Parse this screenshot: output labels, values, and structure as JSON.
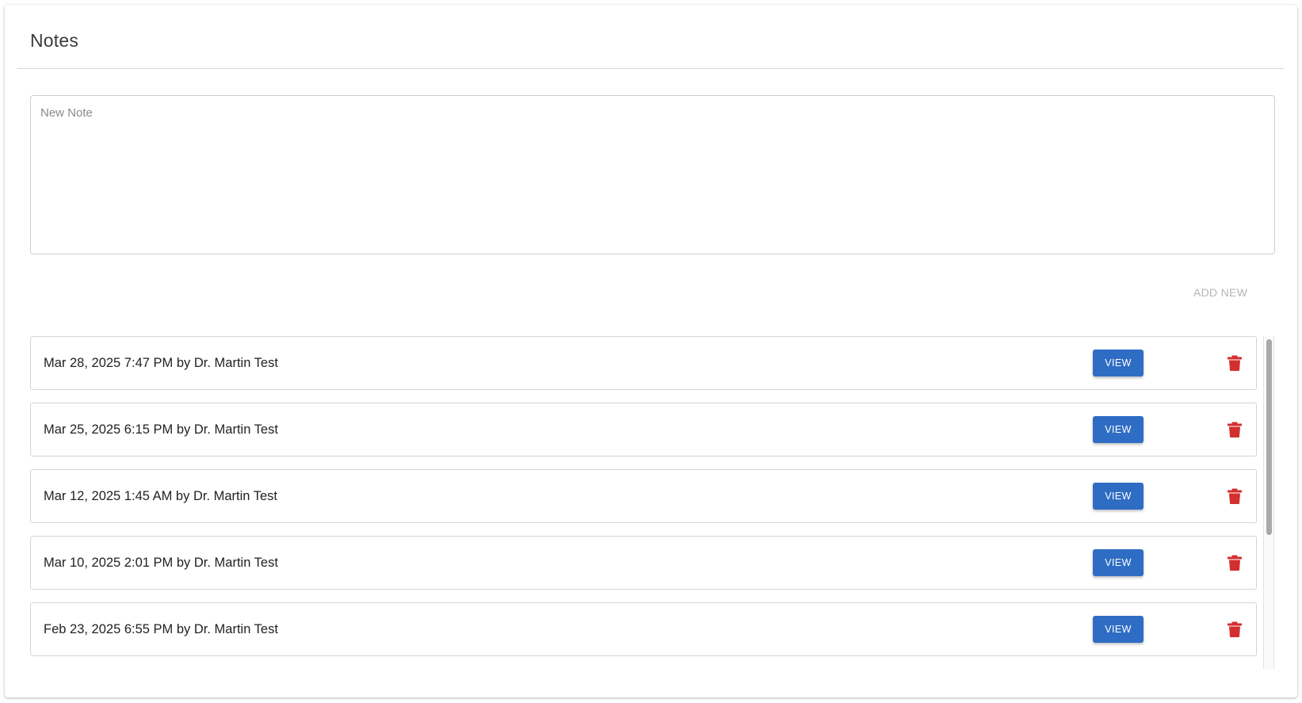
{
  "panel": {
    "title": "Notes"
  },
  "new_note": {
    "placeholder": "New Note",
    "value": ""
  },
  "add_new_label": "ADD NEW",
  "colors": {
    "primary_button": "#2f6dc4",
    "delete_icon": "#d32f2f",
    "add_new_disabled": "#b5b5b5"
  },
  "notes": [
    {
      "label": "Mar 28, 2025 7:47 PM by Dr. Martin Test",
      "view_label": "VIEW",
      "delete_icon": "trash-icon"
    },
    {
      "label": "Mar 25, 2025 6:15 PM by Dr. Martin Test",
      "view_label": "VIEW",
      "delete_icon": "trash-icon"
    },
    {
      "label": "Mar 12, 2025 1:45 AM by Dr. Martin Test",
      "view_label": "VIEW",
      "delete_icon": "trash-icon"
    },
    {
      "label": "Mar 10, 2025 2:01 PM by Dr. Martin Test",
      "view_label": "VIEW",
      "delete_icon": "trash-icon"
    },
    {
      "label": "Feb 23, 2025 6:55 PM by Dr. Martin Test",
      "view_label": "VIEW",
      "delete_icon": "trash-icon"
    }
  ]
}
